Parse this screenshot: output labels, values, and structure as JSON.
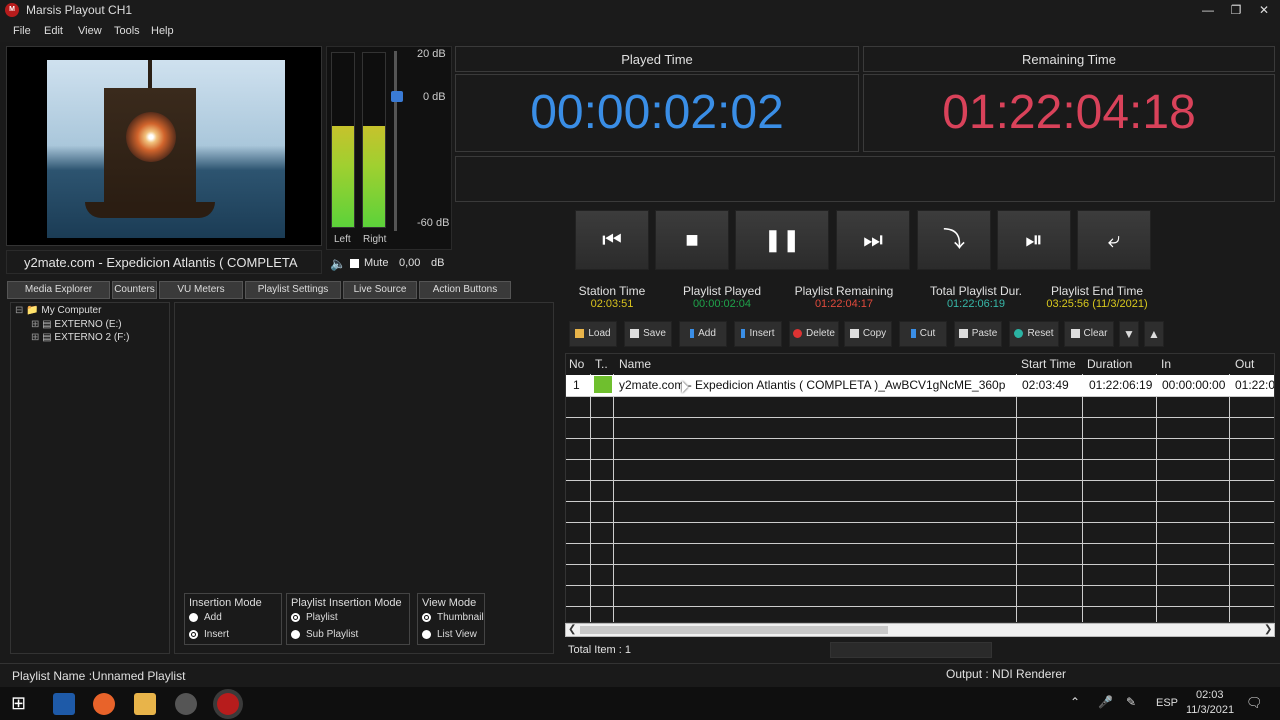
{
  "window": {
    "title": "Marsis Playout CH1",
    "logo": "M"
  },
  "menu": [
    "File",
    "Edit",
    "View",
    "Tools",
    "Help"
  ],
  "preview": {
    "title": "y2mate.com - Expedicion Atlantis ( COMPLETA"
  },
  "vu": {
    "ticks": [
      "20 dB",
      "0 dB",
      "-60 dB"
    ],
    "left_label": "Left",
    "right_label": "Right",
    "left_level": 0.58,
    "right_level": 0.58,
    "mute_label": "Mute",
    "volume_value": "0,00",
    "volume_unit": "dB"
  },
  "counters": {
    "played_label": "Played Time",
    "played_value": "00:00:02:02",
    "remaining_label": "Remaining Time",
    "remaining_value": "01:22:04:18"
  },
  "transport": [
    "first-icon",
    "stop-icon",
    "pause-icon",
    "next-icon",
    "jump-icon",
    "play-next-icon",
    "return-icon"
  ],
  "tabs": [
    "Media Explorer",
    "Counters",
    "VU Meters",
    "Playlist Settings",
    "Live Source",
    "Action Buttons"
  ],
  "tree": {
    "root": "My Computer",
    "drives": [
      "EXTERNO (E:)",
      "EXTERNO 2 (F:)"
    ]
  },
  "modes": {
    "insertion": {
      "title": "Insertion Mode",
      "options": [
        "Add",
        "Insert"
      ]
    },
    "playlist_insertion": {
      "title": "Playlist Insertion Mode",
      "options": [
        "Playlist",
        "Sub Playlist"
      ]
    },
    "view": {
      "title": "View Mode",
      "options": [
        "Thumbnail",
        "List View"
      ]
    }
  },
  "stats": {
    "station_time_label": "Station Time",
    "station_time": "02:03:51",
    "playlist_played_label": "Playlist Played",
    "playlist_played": "00:00:02:04",
    "playlist_remaining_label": "Playlist Remaining",
    "playlist_remaining": "01:22:04:17",
    "total_dur_label": "Total Playlist Dur.",
    "total_dur": "01:22:06:19",
    "end_time_label": "Playlist End Time",
    "end_time": "03:25:56 (11/3/2021)"
  },
  "toolbar": [
    "Load",
    "Save",
    "Add",
    "Insert",
    "Delete",
    "Copy",
    "Cut",
    "Paste",
    "Reset",
    "Clear"
  ],
  "grid": {
    "headers": [
      "No",
      "T..",
      "Name",
      "Start Time",
      "Duration",
      "In",
      "Out"
    ],
    "rows": [
      {
        "no": "1",
        "name": "y2mate.com - Expedicion Atlantis ( COMPLETA )_AwBCV1gNcME_360p",
        "start": "02:03:49",
        "duration": "01:22:06:19",
        "in": "00:00:00:00",
        "out": "01:22:0"
      }
    ]
  },
  "total_items": "Total Item : 1",
  "status": {
    "playlist_name": "Playlist Name :Unnamed Playlist",
    "output": "Output : NDI Renderer"
  },
  "taskbar": {
    "lang": "ESP",
    "time": "02:03",
    "date": "11/3/2021"
  },
  "colors": {
    "played": "#3a8ee6",
    "remaining": "#d9425a",
    "station": "#d8c21e",
    "played_green": "#1fa34a",
    "remaining_red": "#e04a3c",
    "total_teal": "#37b7a8",
    "end_yellow": "#d9c91e"
  }
}
